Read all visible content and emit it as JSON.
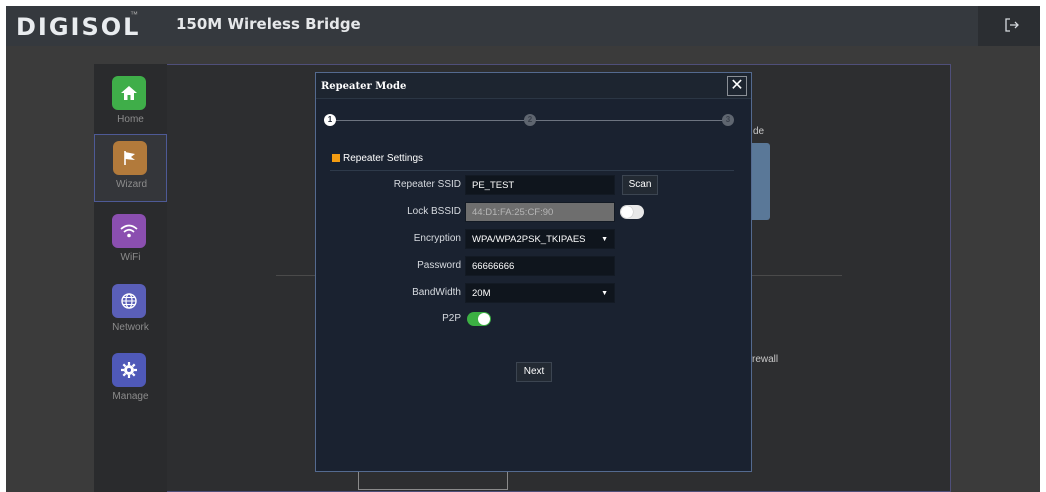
{
  "app": {
    "logo": "DIGISOL",
    "logo_mark": "™",
    "product_title": "150M Wireless Bridge"
  },
  "sidebar": {
    "items": [
      {
        "label": "Home",
        "icon": "home-icon",
        "color": "#3fae49"
      },
      {
        "label": "Wizard",
        "icon": "flag-icon",
        "color": "#b27a3b"
      },
      {
        "label": "WiFi",
        "icon": "wifi-icon",
        "color": "#8b4fb0"
      },
      {
        "label": "Network",
        "icon": "globe-icon",
        "color": "#5a5fb8"
      },
      {
        "label": "Manage",
        "icon": "gear-icon",
        "color": "#4f59b8"
      }
    ],
    "active_index": 1
  },
  "background": {
    "mode_fragment": "de",
    "firewall_fragment": "rewall"
  },
  "dialog": {
    "title": "Repeater Mode",
    "close_symbol": "✕",
    "steps": [
      "1",
      "2",
      "3"
    ],
    "active_step": 1,
    "section_title": "Repeater Settings",
    "fields": {
      "repeater_ssid": {
        "label": "Repeater SSID",
        "value": "PE_TEST"
      },
      "lock_bssid": {
        "label": "Lock BSSID",
        "value": "44:D1:FA:25:CF:90",
        "enabled": false
      },
      "encryption": {
        "label": "Encryption",
        "value": "WPA/WPA2PSK_TKIPAES"
      },
      "password": {
        "label": "Password",
        "value": "66666666"
      },
      "bandwidth": {
        "label": "BandWidth",
        "value": "20M"
      },
      "p2p": {
        "label": "P2P",
        "enabled": true
      }
    },
    "scan_label": "Scan",
    "next_label": "Next"
  },
  "colors": {
    "accent": "#f39c12",
    "toggle_on": "#3cb043"
  }
}
